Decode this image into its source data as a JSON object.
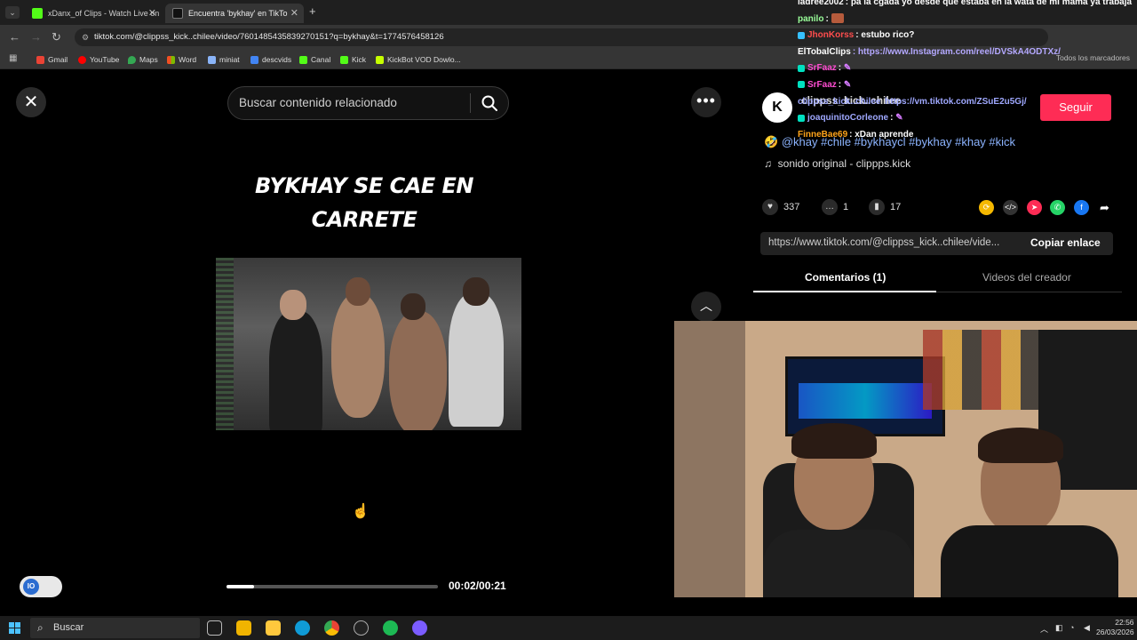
{
  "browser": {
    "tabs": [
      {
        "label": "xDanx_of Clips - Watch Live on",
        "favicon_color": "#53fc18"
      },
      {
        "label": "Encuentra 'bykhay' en TikTo",
        "favicon_color": "#ffffff"
      }
    ],
    "new_tab": "+",
    "url": "tiktok.com/@clippss_kick..chilee/video/7601485435839270151?q=bykhay&t=1774576458126",
    "bookmarks": [
      "Gmail",
      "YouTube",
      "Maps",
      "Word",
      "miniat",
      "descvids",
      "Canal",
      "Kick",
      "KickBot VOD Dowlo..."
    ],
    "bookmarks_all": "Todos los marcadores"
  },
  "search": {
    "placeholder": "Buscar contenido relacionado"
  },
  "video": {
    "title_line1": "BYKHAY SE CAE EN",
    "title_line2": "CARRETE",
    "progress": 0.13,
    "time": "00:02/00:21"
  },
  "creator": {
    "name": "clippss_kick..chilee",
    "follow": "Seguir"
  },
  "post": {
    "hashtags": "@khay #chile #bykhaycl #bykhay #khay #kick",
    "emoji": "🤣",
    "sound": "sonido original - clippps.kick"
  },
  "stats": {
    "likes": "337",
    "comments": "1",
    "saves": "17"
  },
  "share": {
    "link": "https://www.tiktok.com/@clippss_kick..chilee/vide...",
    "copy": "Copiar enlace"
  },
  "panel_tabs": {
    "comments": "Comentarios (1)",
    "creator_videos": "Videos del creador"
  },
  "chat": [
    {
      "user": "ladree2002",
      "text": ": pa la cgada yo desde que estaba en la wata de mi mamá ya trabaja",
      "color": "#ffffff"
    },
    {
      "user": "panilo",
      "text": ":",
      "color": "#ffffff"
    },
    {
      "user": "JhonKorss",
      "text": ": estubo rico?",
      "color": "#ff4d4d"
    },
    {
      "user": "ElTobalClips",
      "text": ": https://www.Instagram.com/reel/DVSkA4ODTXz/",
      "color": "#ffffff"
    },
    {
      "user": "SrFaaz",
      "text": ":",
      "color": "#ff4dd2"
    },
    {
      "user": "SrFaaz",
      "text": ":",
      "color": "#ff4dd2"
    },
    {
      "user": "clippss_kick..chilee",
      "text": "https://vm.tiktok.com/ZSuE2u5Gj/",
      "color": "#9fa8ff"
    },
    {
      "user": "joaquinitoCorleone",
      "text": ":",
      "color": "#9fa8ff"
    },
    {
      "user": "FinneBae69",
      "text": ": xDan aprende",
      "color": "#ffa41a"
    }
  ],
  "taskbar": {
    "search": "Buscar",
    "time": "22:56",
    "date": "26/03/2026"
  },
  "colors": {
    "accent": "#fe2c55",
    "hashtag": "#8cb4ff"
  }
}
